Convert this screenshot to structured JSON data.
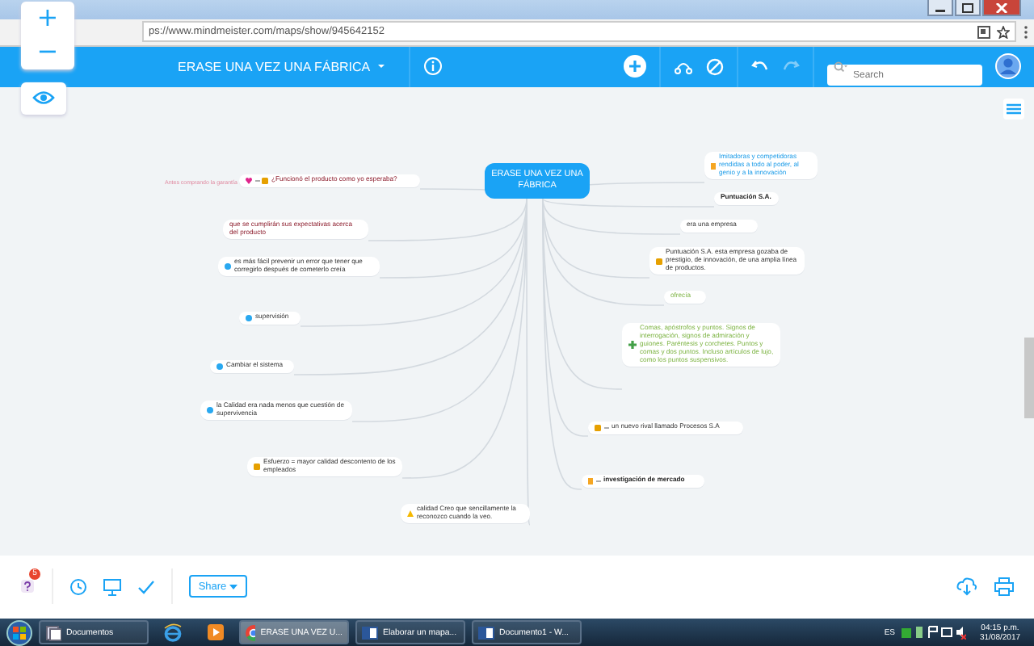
{
  "browser": {
    "address": "ps://www.mindmeister.com/maps/show/945642152"
  },
  "toolbar": {
    "title": "ERASE UNA VEZ UNA FÁBRICA",
    "search": {
      "placeholder": "Search"
    },
    "redo_disabled": true
  },
  "zoom_controls": {
    "zoom_in": "+",
    "zoom_out": "−"
  },
  "map": {
    "root": "ERASE UNA VEZ UNA FÁBRICA",
    "left": [
      {
        "text": "¿Funcionó el producto como yo esperaba?",
        "note": "Antes comprando la garantía",
        "kind": "question",
        "icons": [
          {
            "kind": "heart"
          },
          {
            "kind": "dash"
          },
          {
            "kind": "task"
          }
        ]
      },
      {
        "text": "que se cumplirán sus expectativas acerca del producto",
        "kind": "question"
      },
      {
        "text": "es más fácil prevenir un error que tener que corregirlo después de cometerlo creía",
        "kind": "plain",
        "icons": [
          {
            "kind": "bullet"
          }
        ]
      },
      {
        "text": "supervisión",
        "kind": "plain",
        "icons": [
          {
            "kind": "bullet"
          }
        ]
      },
      {
        "text": "Cambiar el sistema",
        "kind": "plain",
        "icons": [
          {
            "kind": "bullet"
          }
        ]
      },
      {
        "text": "la Calidad era nada menos que cuestión de supervivencia",
        "kind": "plain",
        "icons": [
          {
            "kind": "bullet"
          }
        ]
      },
      {
        "text": "Esfuerzo = mayor calidad descontento de los empleados",
        "kind": "plain",
        "icons": [
          {
            "kind": "task"
          }
        ]
      },
      {
        "text": "calidad Creo que sencillamente la reconozco cuando la veo.",
        "kind": "plain",
        "icons": [
          {
            "kind": "warning"
          }
        ]
      }
    ],
    "right": [
      {
        "text": "Imitadoras y competidoras rendidas a todo al poder, al genio y a la innovación",
        "kind": "info",
        "icons": [
          {
            "kind": "flag"
          }
        ]
      },
      {
        "text": "Puntuación S.A.",
        "kind": "title"
      },
      {
        "text": "era una empresa",
        "kind": "plain"
      },
      {
        "text": "Puntuación S.A. esta empresa gozaba de prestigio, de innovación, de una amplia línea de productos.",
        "kind": "plain",
        "icons": [
          {
            "kind": "task"
          }
        ]
      },
      {
        "text": "ofrecía",
        "kind": "idea"
      },
      {
        "text": "Comas, apóstrofos y puntos. Signos de interrogación, signos de admiración y guiones. Paréntesis y corchetes. Puntos y comas y dos puntos. Incluso artículos de lujo, como los puntos suspensivos.",
        "kind": "idea",
        "icons": [
          {
            "kind": "plus"
          }
        ]
      },
      {
        "text": "un nuevo rival llamado Procesos S.A",
        "kind": "plain",
        "icons": [
          {
            "kind": "task"
          },
          {
            "kind": "dash"
          }
        ]
      },
      {
        "text": "investigación de mercado",
        "kind": "title",
        "icons": [
          {
            "kind": "flag"
          },
          {
            "kind": "dash"
          }
        ]
      }
    ]
  },
  "bottom_bar": {
    "notification_count": "5",
    "share": "Share"
  },
  "taskbar": {
    "items": [
      {
        "label": "Documentos",
        "kind": "folder",
        "selected": false
      },
      {
        "kind": "ie",
        "selected": false
      },
      {
        "kind": "media",
        "selected": false
      },
      {
        "label": "ERASE UNA VEZ U...",
        "kind": "chrome",
        "selected": true
      },
      {
        "label": "Elaborar un mapa...",
        "kind": "word",
        "selected": false
      },
      {
        "label": "Documento1 - W...",
        "kind": "word",
        "selected": false
      }
    ],
    "language": "ES",
    "time": "04:15 p.m.",
    "date": "31/08/2017"
  }
}
